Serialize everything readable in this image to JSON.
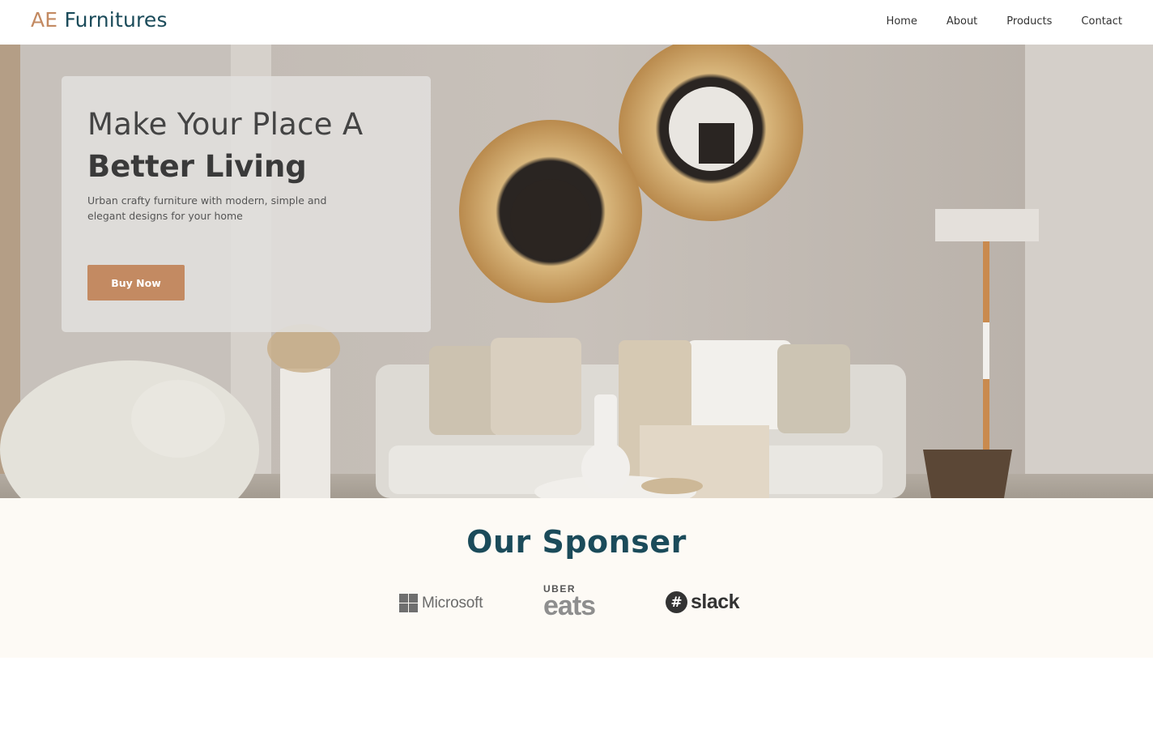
{
  "header": {
    "logo_prefix": "AE",
    "logo_suffix": "Furnitures",
    "nav": [
      {
        "label": "Home"
      },
      {
        "label": "About"
      },
      {
        "label": "Products"
      },
      {
        "label": "Contact"
      }
    ]
  },
  "hero": {
    "title_line1": "Make Your Place A",
    "title_line2": "Better Living",
    "description": "Urban crafty furniture with modern, simple and elegant designs for your home",
    "cta_label": "Buy Now"
  },
  "sponsor": {
    "title": "Our Sponser",
    "logos": [
      {
        "name": "Microsoft",
        "text": "Microsoft",
        "icon": "microsoft-logo-icon"
      },
      {
        "name": "Uber Eats",
        "top": "UBER",
        "bottom": "eats",
        "icon": "uber-eats-logo-icon"
      },
      {
        "name": "Slack",
        "text": "slack",
        "icon": "slack-logo-icon"
      }
    ]
  },
  "colors": {
    "brand_accent": "#c38a62",
    "brand_dark": "#1b4b5a",
    "sponsor_bg": "#fdfaf5"
  }
}
